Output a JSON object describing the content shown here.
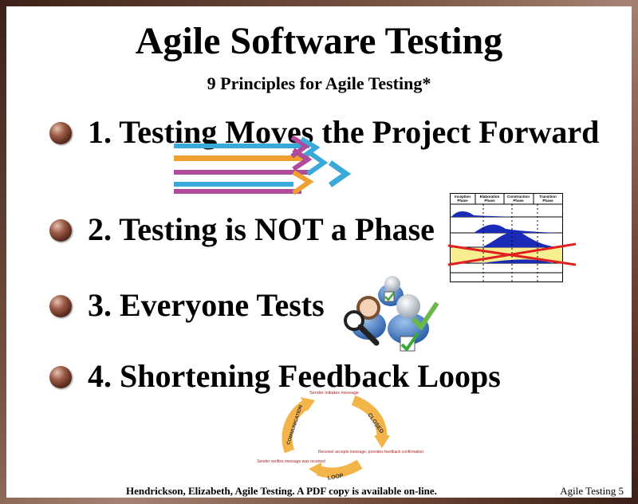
{
  "title": "Agile Software Testing",
  "subtitle": "9 Principles for Agile Testing*",
  "principles": [
    {
      "label": "1. Testing Moves the Project Forward"
    },
    {
      "label": "2. Testing is NOT a Phase"
    },
    {
      "label": "3. Everyone Tests"
    },
    {
      "label": "4. Shortening Feedback Loops"
    }
  ],
  "phase_chart": {
    "headers": [
      "Inception Phase",
      "Elaboration Phase",
      "Construction Phase",
      "Transition Phase"
    ]
  },
  "loop_diagram": {
    "sender_initiates": "Sender initiates message",
    "closed": "CLOSED",
    "receiver_accepts": "Receiver accepts message, provides feedback confirmation",
    "loop": "LOOP",
    "sender_verifies": "Sender verifies message was received",
    "communication": "COMMUNICATION"
  },
  "footer": "Hendrickson, Elizabeth, Agile Testing.  A PDF copy is available on-line.",
  "page_label": "Agile Testing 5",
  "colors": {
    "arrow_cyan": "#3aa8d8",
    "arrow_orange": "#f0a030",
    "arrow_purple": "#b04a9a",
    "loop_arrow": "#f3b54a"
  }
}
